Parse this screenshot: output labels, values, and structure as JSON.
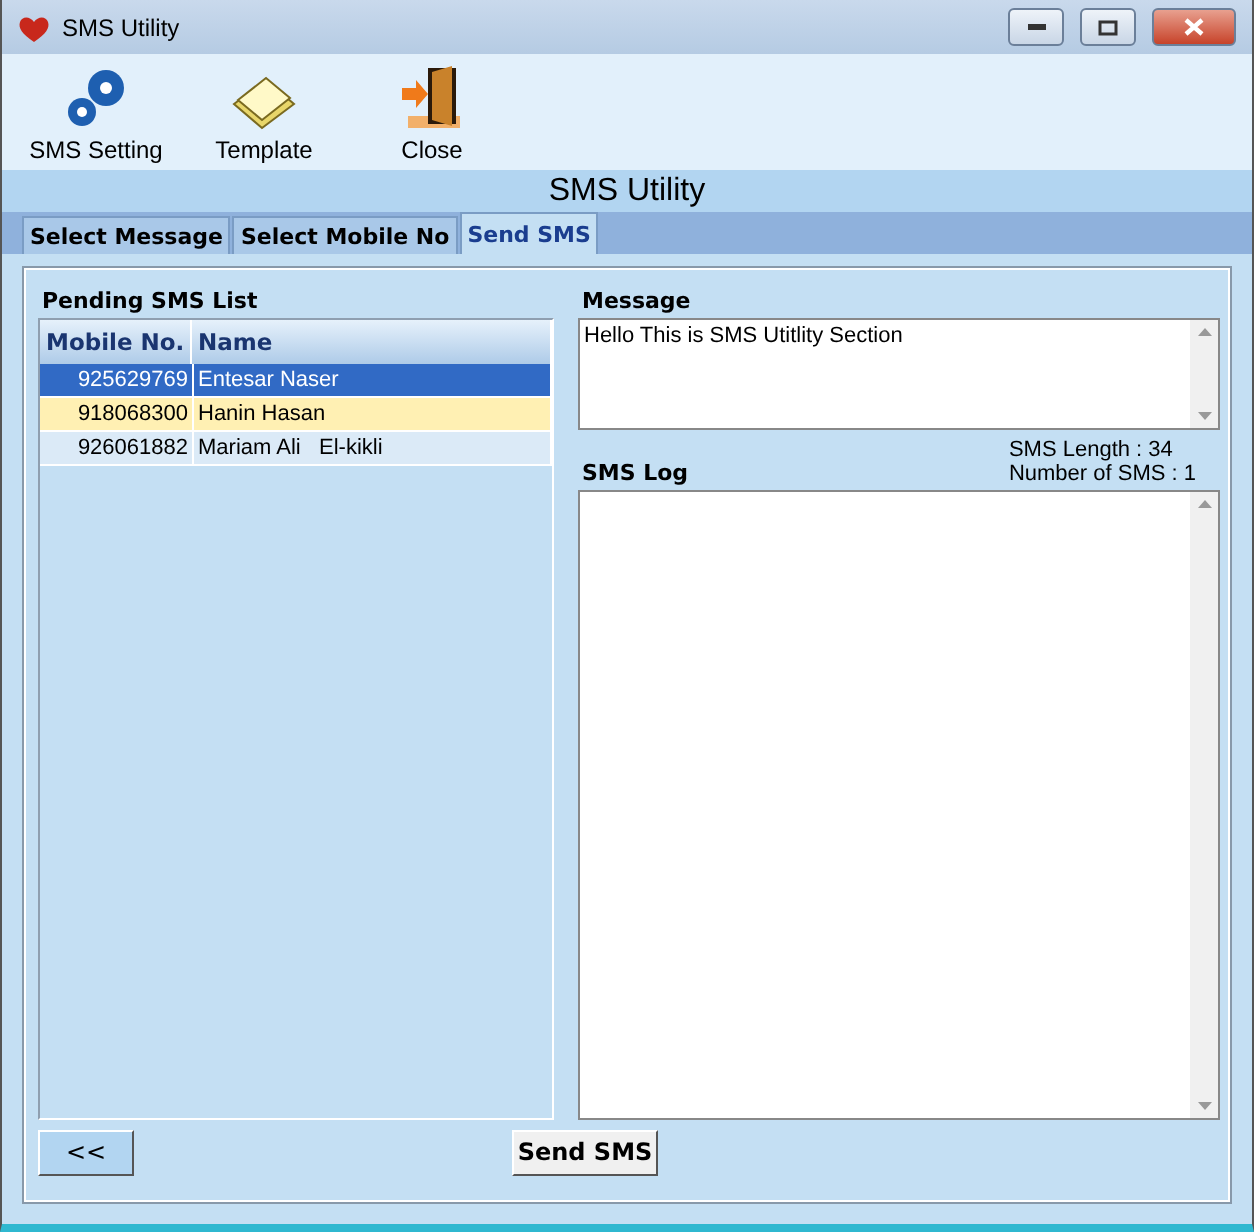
{
  "window": {
    "title": "SMS Utility"
  },
  "toolbar": [
    {
      "kind": "gears",
      "label": "SMS Setting"
    },
    {
      "kind": "notes",
      "label": "Template"
    },
    {
      "kind": "door",
      "label": "Close"
    }
  ],
  "heading": "SMS Utility",
  "tabs": [
    {
      "label": "Select Message",
      "selected": false
    },
    {
      "label": "Select Mobile No",
      "selected": false
    },
    {
      "label": "Send SMS",
      "selected": true
    }
  ],
  "pending": {
    "title": "Pending SMS List",
    "columns": [
      "Mobile No.",
      "Name"
    ],
    "rows": [
      {
        "mobile": "925629769",
        "name": "Entesar Naser",
        "selected": true,
        "highlighted": false
      },
      {
        "mobile": "918068300",
        "name": "Hanin Hasan",
        "selected": false,
        "highlighted": true
      },
      {
        "mobile": "926061882",
        "name": "Mariam Ali   El-kikli",
        "selected": false,
        "highlighted": false
      }
    ]
  },
  "message": {
    "label": "Message",
    "value": "Hello This is SMS Utitlity Section"
  },
  "sms_length": "SMS Length : 34",
  "sms_count": "Number of SMS : 1",
  "log": {
    "label": "SMS Log"
  },
  "buttons": {
    "back": "<<",
    "send": "Send SMS"
  }
}
